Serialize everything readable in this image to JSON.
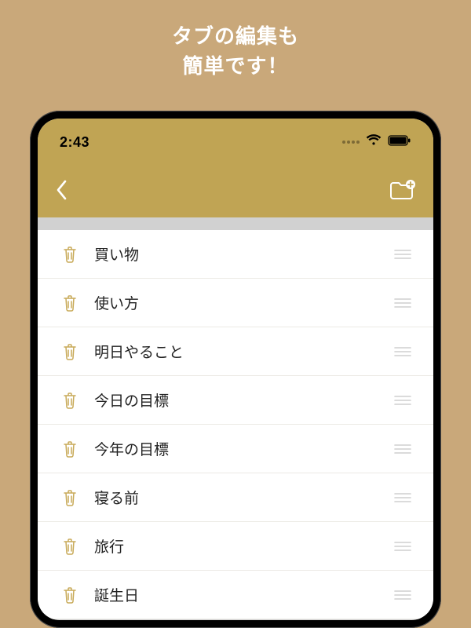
{
  "promo": {
    "line1": "タブの編集も",
    "line2": "簡単です！"
  },
  "status": {
    "time": "2:43"
  },
  "tabs": [
    {
      "label": "買い物"
    },
    {
      "label": "使い方"
    },
    {
      "label": "明日やること"
    },
    {
      "label": "今日の目標"
    },
    {
      "label": "今年の目標"
    },
    {
      "label": "寝る前"
    },
    {
      "label": "旅行"
    },
    {
      "label": "誕生日"
    }
  ],
  "colors": {
    "accent": "#c0a454",
    "background": "#c9a87a",
    "iconGold": "#c8aa58"
  }
}
